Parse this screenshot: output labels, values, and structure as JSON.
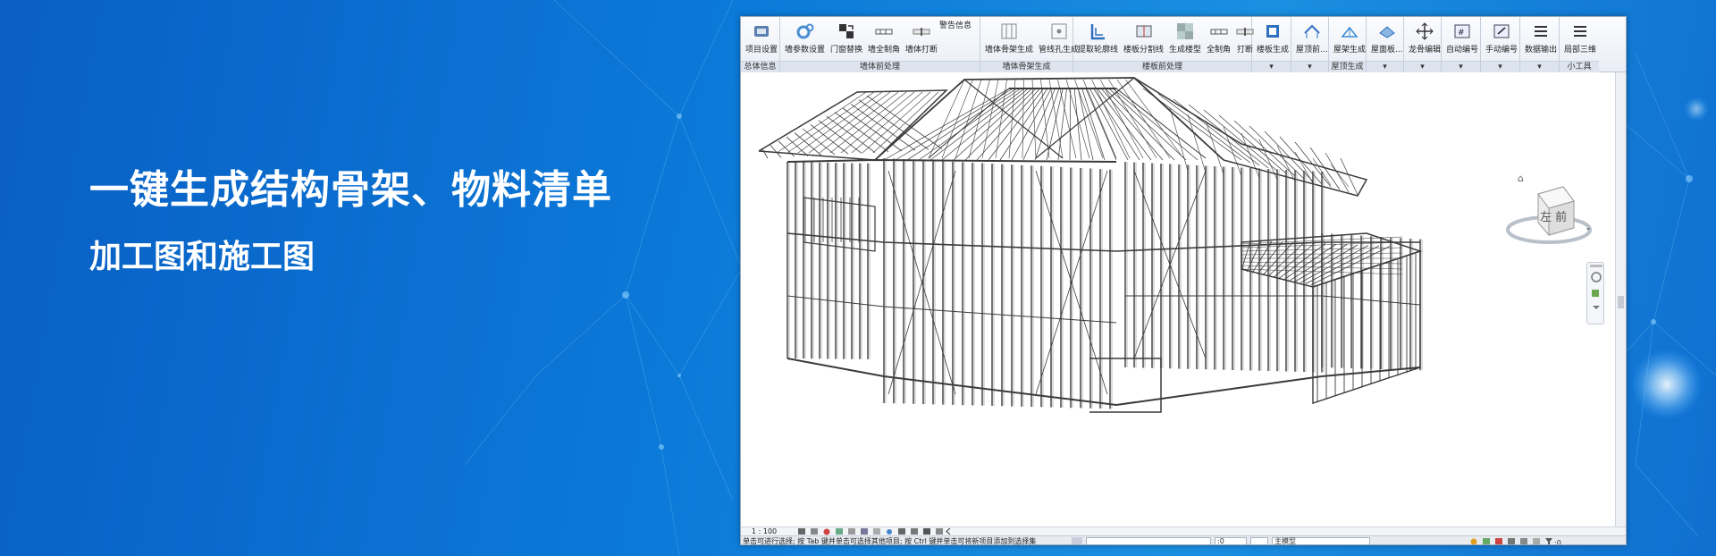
{
  "hero": {
    "headline": "一键生成结构骨架、物料清单",
    "subline": "加工图和施工图"
  },
  "ribbon": {
    "warning_label": "警告信息",
    "groups": [
      {
        "label": "总体信息",
        "buttons": [
          "项目设置"
        ]
      },
      {
        "label": "",
        "buttons": [
          "墙参数设置",
          "门窗替换",
          "墙全制角",
          "墙体打断"
        ]
      },
      {
        "label": "墙体前处理",
        "buttons": []
      },
      {
        "label": "墙体骨架生成",
        "buttons": [
          "墙体骨架生成",
          "管线孔生成"
        ]
      },
      {
        "label": "楼板前处理",
        "buttons": [
          "提取轮廓线",
          "楼板分割线",
          "生成楼型",
          "全制角",
          "打断"
        ]
      },
      {
        "label": "",
        "buttons": [
          "楼板生成"
        ]
      },
      {
        "label": "",
        "buttons": [
          "屋顶前..."
        ]
      },
      {
        "label": "屋顶生成",
        "buttons": [
          "屋架生成"
        ]
      },
      {
        "label": "",
        "buttons": [
          "屋面板..."
        ]
      },
      {
        "label": "",
        "buttons": [
          "龙骨编辑"
        ]
      },
      {
        "label": "",
        "buttons": [
          "自动编号"
        ]
      },
      {
        "label": "",
        "buttons": [
          "手动编号"
        ]
      },
      {
        "label": "",
        "buttons": [
          "数据输出"
        ]
      },
      {
        "label": "小工具",
        "buttons": [
          "局部三维"
        ]
      }
    ]
  },
  "viewcube": {
    "face_label": "左 前"
  },
  "viewbar": {
    "scale": "1 : 100"
  },
  "statusbar": {
    "message": "单击可进行选择; 按 Tab 键并单击可选择其他项目; 按 Ctrl 键并单击可将新项目添加到选择集",
    "zero_field": ":0",
    "model_field": "主模型"
  },
  "colors": {
    "accent_blue": "#0b79d8",
    "frame_dark": "#3a3a3a"
  }
}
